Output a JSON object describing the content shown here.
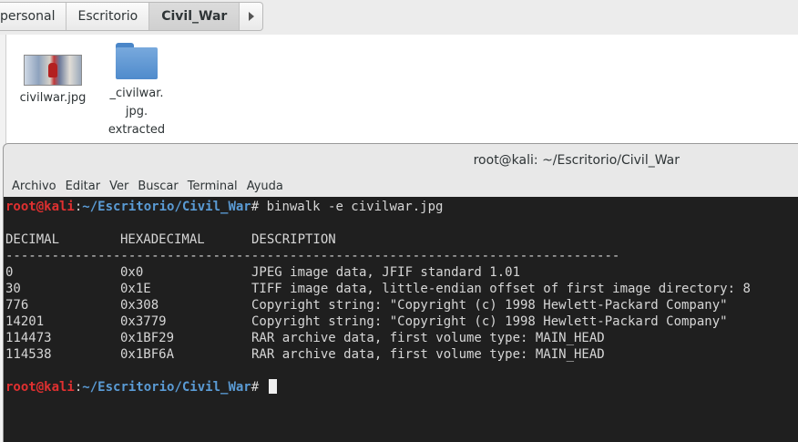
{
  "pathbar": {
    "crumbs": [
      "personal",
      "Escritorio",
      "Civil_War"
    ],
    "more_icon": "chevron-right-icon"
  },
  "files": [
    {
      "name": "civilwar.jpg",
      "type": "image-thumbnail"
    },
    {
      "name_lines": [
        "_civilwar.",
        "jpg.",
        "extracted"
      ],
      "type": "folder-icon"
    }
  ],
  "terminal": {
    "title": "root@kali: ~/Escritorio/Civil_War",
    "menu": [
      "Archivo",
      "Editar",
      "Ver",
      "Buscar",
      "Terminal",
      "Ayuda"
    ],
    "prompt_user": "root@kali",
    "prompt_sep": ":",
    "prompt_path": "~/Escritorio/Civil_War",
    "prompt_symbol": "# ",
    "command": "binwalk -e civilwar.jpg",
    "headers": [
      "DECIMAL",
      "HEXADECIMAL",
      "DESCRIPTION"
    ],
    "separator": "--------------------------------------------------------------------------------",
    "rows": [
      [
        "0",
        "0x0",
        "JPEG image data, JFIF standard 1.01"
      ],
      [
        "30",
        "0x1E",
        "TIFF image data, little-endian offset of first image directory: 8"
      ],
      [
        "776",
        "0x308",
        "Copyright string: \"Copyright (c) 1998 Hewlett-Packard Company\""
      ],
      [
        "14201",
        "0x3779",
        "Copyright string: \"Copyright (c) 1998 Hewlett-Packard Company\""
      ],
      [
        "114473",
        "0x1BF29",
        "RAR archive data, first volume type: MAIN_HEAD"
      ],
      [
        "114538",
        "0x1BF6A",
        "RAR archive data, first volume type: MAIN_HEAD"
      ]
    ]
  }
}
